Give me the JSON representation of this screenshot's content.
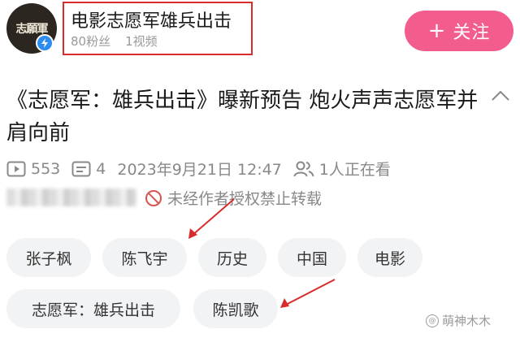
{
  "channel": {
    "avatar_text": "志願軍",
    "name": "电影志愿军雄兵出击",
    "followers": "80粉丝",
    "videos": "1视频"
  },
  "follow_button": {
    "plus": "+",
    "label": "关注"
  },
  "video": {
    "title": "《志愿军：雄兵出击》曝新预告 炮火声声志愿军并肩向前",
    "plays": "553",
    "comments": "4",
    "date": "2023年9月21日 12:47",
    "watching": "1人正在看",
    "copyright": "未经作者授权禁止转载"
  },
  "tags": [
    "张子枫",
    "陈飞宇",
    "历史",
    "中国",
    "电影",
    "志愿军：雄兵出击",
    "陈凯歌"
  ],
  "watermark": "萌神木木",
  "colors": {
    "accent": "#f25d8e",
    "highlight": "#d92b2b",
    "verified": "#2d8cf0",
    "tag_bg": "#f2f3f5",
    "muted": "#888888"
  },
  "icons": [
    "play-count-icon",
    "comment-icon",
    "watching-icon",
    "no-repost-icon",
    "collapse-chevron-icon",
    "verified-icon"
  ]
}
